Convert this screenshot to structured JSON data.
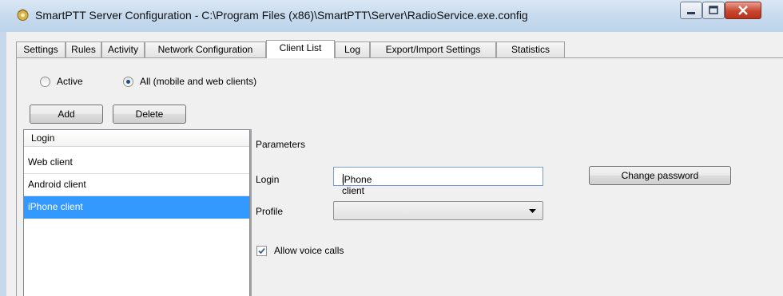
{
  "window": {
    "title": "SmartPTT Server Configuration - C:\\Program Files (x86)\\SmartPTT\\Server\\RadioService.exe.config"
  },
  "tabs": [
    {
      "label": "Settings"
    },
    {
      "label": "Rules"
    },
    {
      "label": "Activity"
    },
    {
      "label": "Network Configuration"
    },
    {
      "label": "Client List",
      "active": true
    },
    {
      "label": "Log"
    },
    {
      "label": "Export/Import Settings"
    },
    {
      "label": "Statistics"
    }
  ],
  "filter": {
    "active_label": "Active",
    "all_label": "All (mobile and web clients)",
    "selected": "all"
  },
  "toolbar": {
    "add_label": "Add",
    "delete_label": "Delete"
  },
  "client_list": {
    "header": "Login",
    "items": [
      "Web client",
      "Android client",
      "iPhone client"
    ],
    "selected_index": 2
  },
  "parameters": {
    "group_label": "Parameters",
    "login_label": "Login",
    "login_value": "iPhone client",
    "change_password_label": "Change password",
    "profile_label": "Profile",
    "profile_value": "",
    "allow_voice_calls_label": "Allow voice calls",
    "allow_voice_calls_checked": true
  },
  "icons": {
    "app": "smartptt-icon",
    "minimize": "minimize-icon",
    "maximize": "maximize-icon",
    "close": "close-icon",
    "dropdown": "chevron-down-icon"
  }
}
